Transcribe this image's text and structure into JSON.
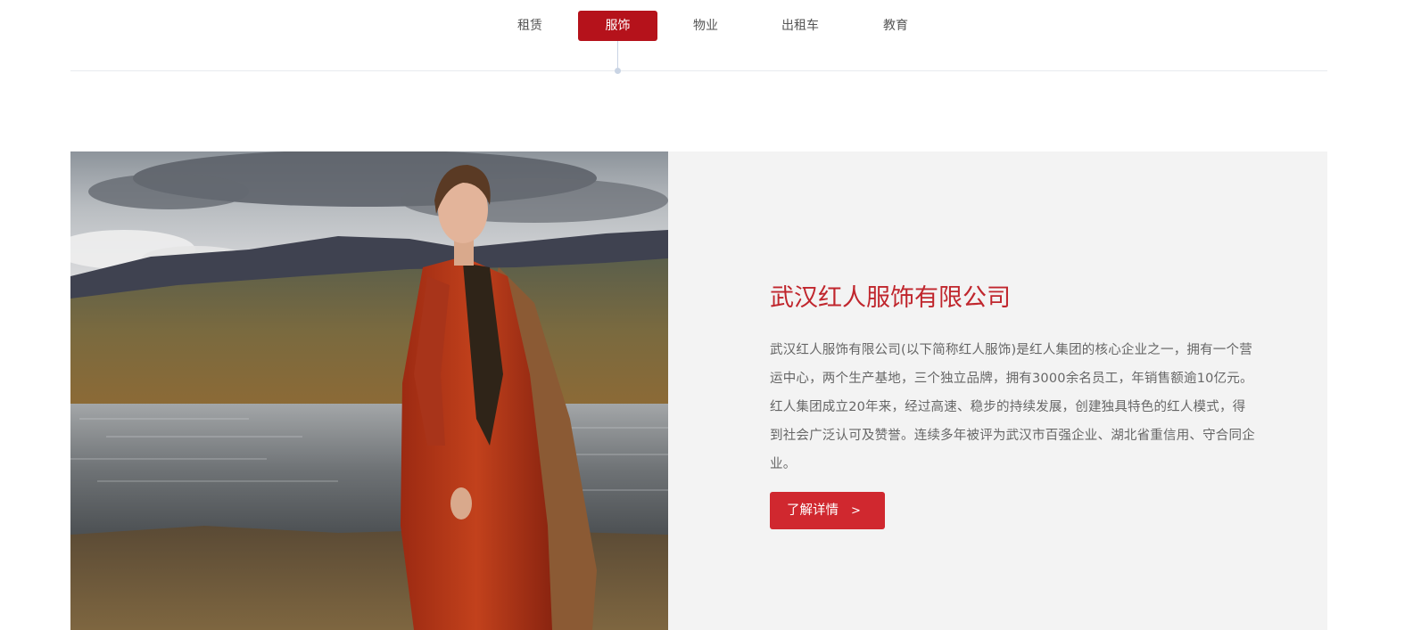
{
  "tabs": [
    {
      "label": "租赁",
      "active": false
    },
    {
      "label": "服饰",
      "active": true
    },
    {
      "label": "物业",
      "active": false
    },
    {
      "label": "出租车",
      "active": false
    },
    {
      "label": "教育",
      "active": false
    }
  ],
  "colors": {
    "accent": "#b5121b",
    "title": "#c0262d",
    "button": "#d0282f",
    "panel_bg": "#f3f3f3"
  },
  "company": {
    "title": "武汉红人服饰有限公司",
    "description": "武汉红人服饰有限公司(以下简称红人服饰)是红人集团的核心企业之一，拥有一个营运中心，两个生产基地，三个独立品牌，拥有3000余名员工，年销售额逾10亿元。红人集团成立20年来，经过高速、稳步的持续发展，创建独具特色的红人模式，得到社会广泛认可及赞誉。连续多年被评为武汉市百强企业、湖北省重信用、守合同企业。",
    "more_label": "了解详情",
    "more_arrow": ">"
  },
  "photo": {
    "icon": "fashion-model-photo"
  }
}
